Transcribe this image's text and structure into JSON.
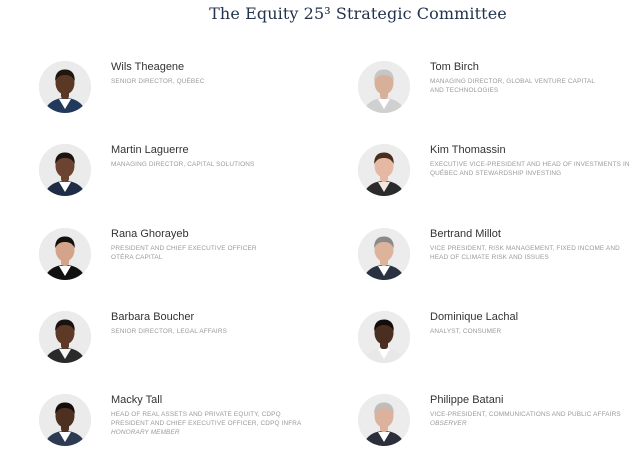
{
  "heading": "The Equity 25³ Strategic Committee",
  "members": [
    {
      "name": "Wils Theagene",
      "role_lines": [
        "SENIOR DIRECTOR, QUÉBEC"
      ],
      "note": "",
      "avatar_icon": "person-portrait-icon",
      "avatar_colors": {
        "bg": "#ebebeb",
        "skin": "#5a3825",
        "hair": "#1f1610",
        "shirt": "#ffffff",
        "suit": "#23395b"
      }
    },
    {
      "name": "Tom Birch",
      "role_lines": [
        "MANAGING DIRECTOR, GLOBAL VENTURE CAPITAL",
        "AND TECHNOLOGIES"
      ],
      "note": "",
      "avatar_icon": "person-portrait-icon",
      "avatar_colors": {
        "bg": "#ececec",
        "skin": "#d8b09a",
        "hair": "#c6c6c6",
        "shirt": "#ffffff",
        "suit": "#d0d0d0"
      }
    },
    {
      "name": "Martin Laguerre",
      "role_lines": [
        "MANAGING DIRECTOR, CAPITAL SOLUTIONS"
      ],
      "note": "",
      "avatar_icon": "person-portrait-icon",
      "avatar_colors": {
        "bg": "#ebebeb",
        "skin": "#6b4330",
        "hair": "#1c1410",
        "shirt": "#ffffff",
        "suit": "#1e2c46"
      }
    },
    {
      "name": "Kim Thomassin",
      "role_lines": [
        "EXECUTIVE VICE-PRESIDENT AND HEAD OF INVESTMENTS IN",
        "QUÉBEC AND STEWARDSHIP INVESTING"
      ],
      "note": "",
      "avatar_icon": "person-portrait-icon",
      "avatar_colors": {
        "bg": "#ececec",
        "skin": "#e4b8a2",
        "hair": "#4a2d1e",
        "shirt": "#f2e8e0",
        "suit": "#2b2b2b"
      }
    },
    {
      "name": "Rana Ghorayeb",
      "role_lines": [
        "PRESIDENT AND CHIEF EXECUTIVE OFFICER",
        "OTÉRA CAPITAL"
      ],
      "note": "",
      "avatar_icon": "person-portrait-icon",
      "avatar_colors": {
        "bg": "#ebebeb",
        "skin": "#d4a48a",
        "hair": "#141010",
        "shirt": "#ffffff",
        "suit": "#111111"
      }
    },
    {
      "name": "Bertrand Millot",
      "role_lines": [
        "VICE PRESIDENT, RISK MANAGEMENT, FIXED INCOME AND",
        "HEAD OF CLIMATE RISK AND ISSUES"
      ],
      "note": "",
      "avatar_icon": "person-portrait-icon",
      "avatar_colors": {
        "bg": "#ececec",
        "skin": "#ddb39c",
        "hair": "#8a8a8a",
        "shirt": "#ffffff",
        "suit": "#2a3140"
      }
    },
    {
      "name": "Barbara Boucher",
      "role_lines": [
        "SENIOR DIRECTOR, LEGAL AFFAIRS"
      ],
      "note": "",
      "avatar_icon": "person-portrait-icon",
      "avatar_colors": {
        "bg": "#ebebeb",
        "skin": "#5e3a26",
        "hair": "#1a1410",
        "shirt": "#f5f5f5",
        "suit": "#2a2a2a"
      }
    },
    {
      "name": "Dominique Lachal",
      "role_lines": [
        "ANALYST, CONSUMER"
      ],
      "note": "",
      "avatar_icon": "person-portrait-icon",
      "avatar_colors": {
        "bg": "#ececec",
        "skin": "#4a2e20",
        "hair": "#120e0c",
        "shirt": "#ffffff",
        "suit": "#e8e8e8"
      }
    },
    {
      "name": "Macky Tall",
      "role_lines": [
        "HEAD OF REAL ASSETS AND PRIVATE EQUITY, CDPQ",
        "PRESIDENT AND CHIEF EXECUTIVE OFFICER, CDPQ INFRA"
      ],
      "note": "HONORARY MEMBER",
      "avatar_icon": "person-portrait-icon",
      "avatar_colors": {
        "bg": "#ebebeb",
        "skin": "#4e3020",
        "hair": "#140f0c",
        "shirt": "#ffffff",
        "suit": "#2c3a52"
      }
    },
    {
      "name": "Philippe Batani",
      "role_lines": [
        "VICE-PRESIDENT, COMMUNICATIONS AND PUBLIC AFFAIRS"
      ],
      "note": "OBSERVER",
      "avatar_icon": "person-portrait-icon",
      "avatar_colors": {
        "bg": "#ececec",
        "skin": "#dcb29c",
        "hair": "#bdbdbd",
        "shirt": "#ffffff",
        "suit": "#2a2f3a"
      }
    }
  ]
}
